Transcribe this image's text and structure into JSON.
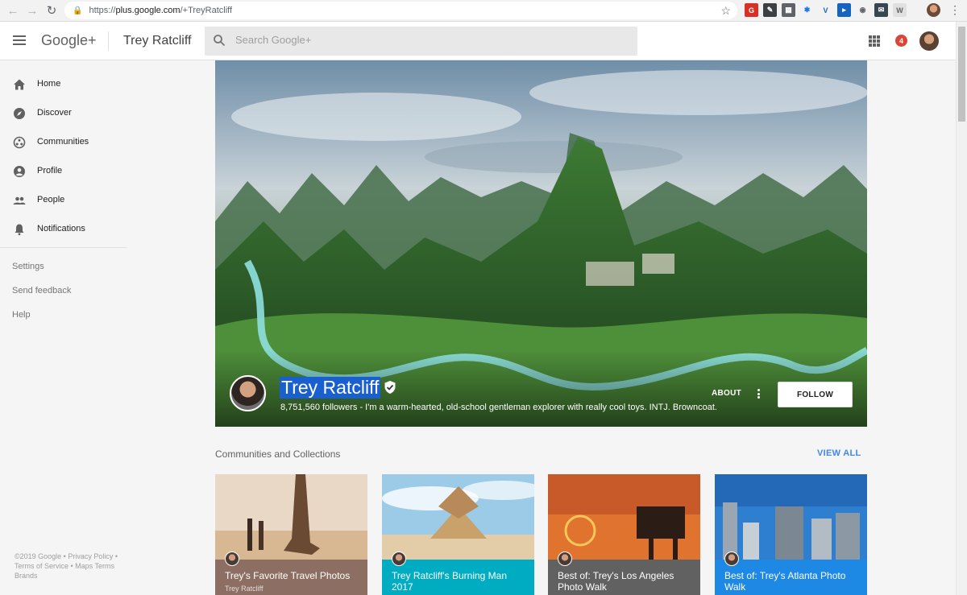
{
  "browser": {
    "url_prefix": "https://",
    "url_host": "plus.google.com",
    "url_path": "/+TreyRatcliff"
  },
  "header": {
    "logo": "Google+",
    "page_title": "Trey Ratcliff",
    "search_placeholder": "Search Google+",
    "notification_count": "4"
  },
  "sidebar": {
    "items": [
      {
        "label": "Home",
        "icon": "home-icon"
      },
      {
        "label": "Discover",
        "icon": "compass-icon"
      },
      {
        "label": "Communities",
        "icon": "communities-icon"
      },
      {
        "label": "Profile",
        "icon": "profile-icon"
      },
      {
        "label": "People",
        "icon": "people-icon"
      },
      {
        "label": "Notifications",
        "icon": "bell-icon"
      }
    ],
    "links": [
      "Settings",
      "Send feedback",
      "Help"
    ],
    "footer": "©2019 Google • Privacy Policy • Terms of Service • Maps Terms Brands"
  },
  "profile": {
    "name": "Trey Ratcliff",
    "tagline": "8,751,560 followers - I'm a warm-hearted, old-school gentleman explorer with really cool toys. INTJ. Browncoat.",
    "about_label": "ABOUT",
    "follow_label": "FOLLOW"
  },
  "collections": {
    "title": "Communities and Collections",
    "view_all": "VIEW ALL",
    "cards": [
      {
        "title": "Trey's Favorite Travel Photos",
        "owner": "Trey Ratcliff",
        "band_color": "#8d6e63"
      },
      {
        "title": "Trey Ratcliff's Burning Man 2017",
        "owner": "",
        "band_color": "#00acc1"
      },
      {
        "title": "Best of: Trey's Los Angeles Photo Walk",
        "owner": "",
        "band_color": "#616161"
      },
      {
        "title": "Best of: Trey's Atlanta Photo Walk",
        "owner": "",
        "band_color": "#1e88e5"
      }
    ]
  },
  "colors": {
    "accent": "#4285f4",
    "badge": "#db4437",
    "selection": "#1a5fd0"
  }
}
